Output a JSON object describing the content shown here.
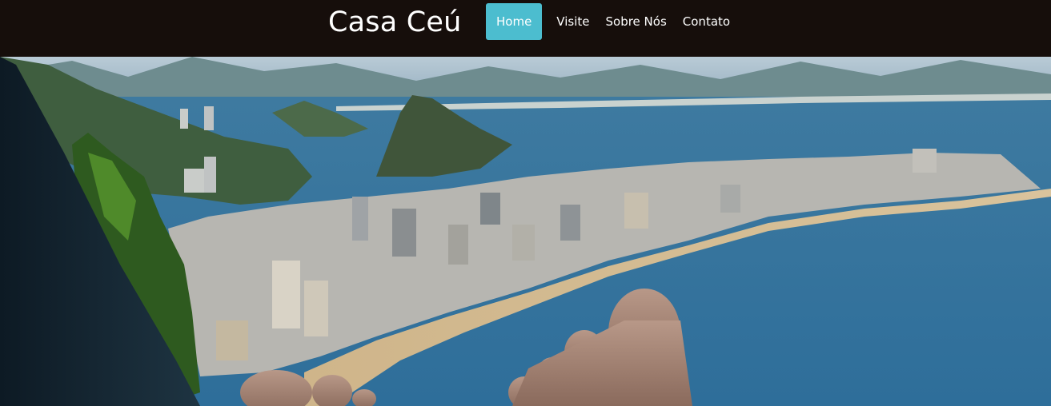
{
  "brand": {
    "title": "Casa Ceú"
  },
  "nav": {
    "items": [
      {
        "label": "Home",
        "active": true
      },
      {
        "label": "Visite",
        "active": false
      },
      {
        "label": "Sobre Nós",
        "active": false
      },
      {
        "label": "Contato",
        "active": false
      }
    ]
  },
  "colors": {
    "navbar_bg": "#160e0b",
    "active_item_bg": "#4cbdcf",
    "nav_text": "#ffffff"
  },
  "hero": {
    "image": "hammock-view-rio-beach"
  }
}
